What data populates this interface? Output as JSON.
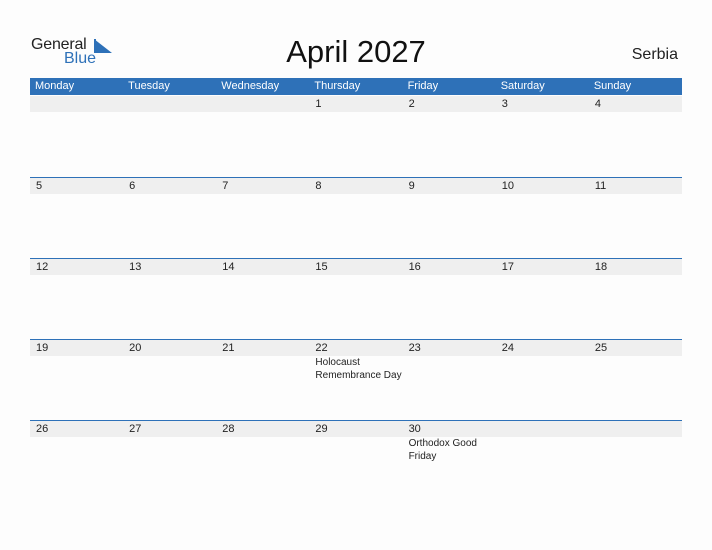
{
  "logo": {
    "general": "General",
    "blue": "Blue"
  },
  "title": "April 2027",
  "country": "Serbia",
  "weekdays": [
    "Monday",
    "Tuesday",
    "Wednesday",
    "Thursday",
    "Friday",
    "Saturday",
    "Sunday"
  ],
  "weeks": [
    {
      "days": [
        {
          "num": "",
          "event": ""
        },
        {
          "num": "",
          "event": ""
        },
        {
          "num": "",
          "event": ""
        },
        {
          "num": "1",
          "event": ""
        },
        {
          "num": "2",
          "event": ""
        },
        {
          "num": "3",
          "event": ""
        },
        {
          "num": "4",
          "event": ""
        }
      ]
    },
    {
      "days": [
        {
          "num": "5",
          "event": ""
        },
        {
          "num": "6",
          "event": ""
        },
        {
          "num": "7",
          "event": ""
        },
        {
          "num": "8",
          "event": ""
        },
        {
          "num": "9",
          "event": ""
        },
        {
          "num": "10",
          "event": ""
        },
        {
          "num": "11",
          "event": ""
        }
      ]
    },
    {
      "days": [
        {
          "num": "12",
          "event": ""
        },
        {
          "num": "13",
          "event": ""
        },
        {
          "num": "14",
          "event": ""
        },
        {
          "num": "15",
          "event": ""
        },
        {
          "num": "16",
          "event": ""
        },
        {
          "num": "17",
          "event": ""
        },
        {
          "num": "18",
          "event": ""
        }
      ]
    },
    {
      "days": [
        {
          "num": "19",
          "event": ""
        },
        {
          "num": "20",
          "event": ""
        },
        {
          "num": "21",
          "event": ""
        },
        {
          "num": "22",
          "event": "Holocaust\nRemembrance Day"
        },
        {
          "num": "23",
          "event": ""
        },
        {
          "num": "24",
          "event": ""
        },
        {
          "num": "25",
          "event": ""
        }
      ]
    },
    {
      "days": [
        {
          "num": "26",
          "event": ""
        },
        {
          "num": "27",
          "event": ""
        },
        {
          "num": "28",
          "event": ""
        },
        {
          "num": "29",
          "event": ""
        },
        {
          "num": "30",
          "event": "Orthodox Good\nFriday"
        },
        {
          "num": "",
          "event": ""
        },
        {
          "num": "",
          "event": ""
        }
      ]
    }
  ],
  "colors": {
    "accent": "#2e71b8",
    "daybar": "#efefef"
  }
}
